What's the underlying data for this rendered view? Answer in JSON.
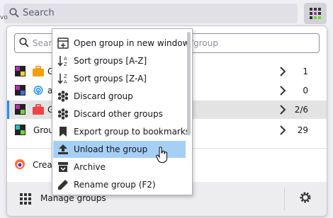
{
  "toolbar": {
    "search_placeholder": "Search",
    "edge_text": "vo"
  },
  "panel": {
    "search_placeholder": "Search",
    "search_suffix": "/group",
    "groups": [
      {
        "name": "G",
        "count": "1",
        "active": false
      },
      {
        "name": "a",
        "count": "0",
        "active": false
      },
      {
        "name": "G",
        "count": "2/6",
        "active": true
      },
      {
        "name": "Group",
        "count": "29",
        "active": false
      }
    ],
    "create_label": "Creat",
    "manage_label": "Manage groups"
  },
  "menu": {
    "items": [
      {
        "label": "Open group in new window",
        "icon": "new-window-icon"
      },
      {
        "label": "Sort groups [A-Z]",
        "icon": "sort-az-icon"
      },
      {
        "label": "Sort groups [Z-A]",
        "icon": "sort-za-icon"
      },
      {
        "label": "Discard group",
        "icon": "snowflake-icon"
      },
      {
        "label": "Discard other groups",
        "icon": "snowflake-icon"
      },
      {
        "label": "Export group to bookmarks",
        "icon": "bookmark-icon"
      },
      {
        "label": "Unload the group",
        "icon": "upload-icon"
      },
      {
        "label": "Archive",
        "icon": "archive-icon"
      },
      {
        "label": "Rename group (F2)",
        "icon": "pencil-icon"
      }
    ]
  },
  "colors": {
    "hover": "#a6cff6",
    "active_edge": "#1e90ff",
    "active_row": "#e3e3e3"
  }
}
